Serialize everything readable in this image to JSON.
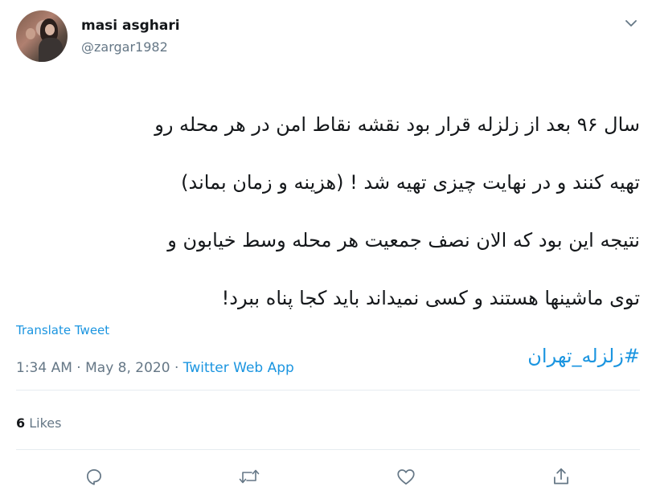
{
  "user": {
    "display_name": "masi asghari",
    "username": "@zargar1982"
  },
  "tweet": {
    "lines": [
      "سال ۹۶ بعد از زلزله قرار بود نقشه نقاط امن در هر محله رو",
      "تهیه کنند و در نهایت چیزی تهیه شد ! (هزینه و زمان بماند)",
      "نتیجه این بود که الان نصف جمعیت هر محله وسط خیابون و",
      "توی ماشینها هستند و کسی نمیداند باید کجا پناه ببرد!"
    ],
    "hashtag": "#زلزله_تهران",
    "translate_label": "Translate Tweet"
  },
  "meta": {
    "time": "1:34 AM",
    "separator": "·",
    "date": "May 8, 2020",
    "source": "Twitter Web App"
  },
  "stats": {
    "likes_count": "6",
    "likes_label": "Likes"
  },
  "actions": {
    "reply_icon": "reply-icon",
    "retweet_icon": "retweet-icon",
    "like_icon": "heart-icon",
    "share_icon": "share-icon"
  },
  "colors": {
    "link": "#1b95e0",
    "secondary_text": "#657786",
    "primary_text": "#14171a",
    "divider": "#e6ecf0"
  }
}
